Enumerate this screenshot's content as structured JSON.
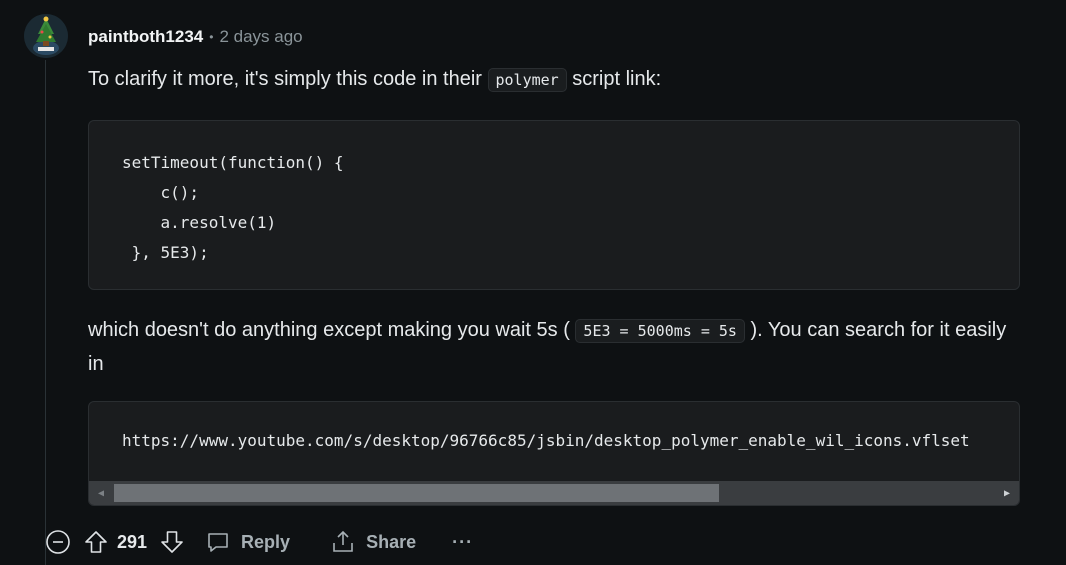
{
  "comment": {
    "username": "paintboth1234",
    "time": "2 days ago",
    "separator": "•",
    "para1_before": "To clarify it more, it's simply this code in their ",
    "para1_code": "polymer",
    "para1_after": " script link:",
    "code_lines": [
      "setTimeout(function() {",
      "    c();",
      "    a.resolve(1)",
      " }, 5E3);"
    ],
    "para2_before": "which doesn't do anything except making you wait 5s ( ",
    "para2_code": "5E3 = 5000ms = 5s",
    "para2_after": " ). You can search for it easily in",
    "url_code": "https://www.youtube.com/s/desktop/96766c85/jsbin/desktop_polymer_enable_wil_icons.vflset"
  },
  "actions": {
    "votes": "291",
    "reply_label": "Reply",
    "share_label": "Share",
    "more_label": "···"
  },
  "icons": {
    "collapse": "minus-circle-icon",
    "upvote": "arrow-up-icon",
    "downvote": "arrow-down-icon",
    "reply": "speech-bubble-icon",
    "share": "share-icon"
  },
  "colors": {
    "background": "#0e1113",
    "code_background": "#1a1c1e",
    "muted_text": "#8a9499"
  }
}
